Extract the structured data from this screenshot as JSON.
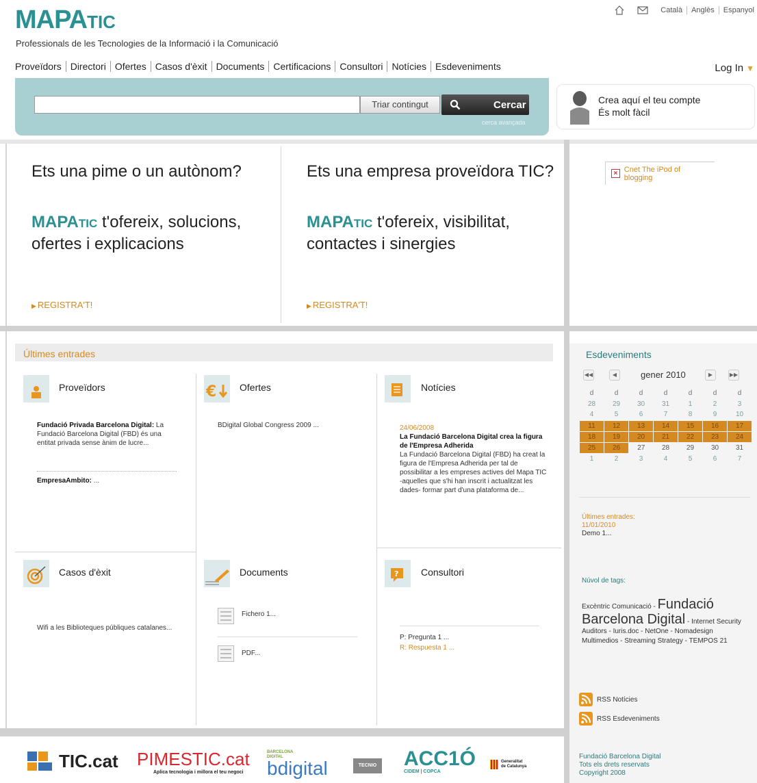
{
  "header": {
    "logo_big": "MAPA",
    "logo_small": "TIC",
    "tagline": "Professionals de les Tecnologies de la Informació i la Comunicació",
    "languages": [
      "Català",
      "Anglès",
      "Espanyol"
    ]
  },
  "nav": {
    "items": [
      "Proveïdors",
      "Directori",
      "Ofertes",
      "Casos d'èxit",
      "Documents",
      "Certificacions",
      "Consultori",
      "Notícies",
      "Esdeveniments"
    ],
    "login": "Log In"
  },
  "search": {
    "value": "",
    "content_select": "Triar contingut",
    "button": "Cercar",
    "advanced": "cerca avançada"
  },
  "account": {
    "line1": "Crea aquí el teu compte",
    "line2": "És molt fàcil"
  },
  "promo": [
    {
      "heading": "Ets una pime o un autònom?",
      "brand_big": "MAPA",
      "brand_small": "TIC",
      "body": " t'ofereix, solucions, ofertes i explicacions",
      "cta": "REGISTRA'T!"
    },
    {
      "heading": "Ets una empresa proveïdora TIC?",
      "brand_big": "MAPA",
      "brand_small": "TIC",
      "body": " t'ofereix, visibilitat, contactes i sinergies",
      "cta": "REGISTRA'T!"
    }
  ],
  "ad": {
    "text": "Cnet The iPod of blogging"
  },
  "ultimes": {
    "title": "Últimes entrades",
    "proveidors": {
      "title": "Proveïdors",
      "entry1_name": "Fundació Privada Barcelona Digital:",
      "entry1_text": " La Fundació Barcelona Digital (FBD) és una entitat privada sense ànim de lucre...",
      "entry2_name": "EmpresaAmbito:",
      "entry2_text": " ..."
    },
    "ofertes": {
      "title": "Ofertes",
      "entry": "BDigital Global Congress 2009 ..."
    },
    "noticies": {
      "title": "Notícies",
      "date": "24/06/2008",
      "headline": "La Fundació Barcelona Digital crea la figura de l'Empresa Adherida",
      "text": "La Fundació Barcelona Digital (FBD) ha creat la figura de l'Empresa Adherida per tal de possibilitar a les empreses actives del Mapa TIC -aquelles que s'hi han inscrit i actualitzat les dades- formar part d'una plataforma de..."
    },
    "casos": {
      "title": "Casos d'èxit",
      "entry": "Wifi a les Biblioteques públiques catalanes..."
    },
    "documents": {
      "title": "Documents",
      "file1": "Fichero 1...",
      "file2": "PDF..."
    },
    "consultori": {
      "title": "Consultori",
      "q": "P: Pregunta 1 ...",
      "r": "R: Respuesta 1 ..."
    }
  },
  "events": {
    "title": "Esdeveniments",
    "month": "gener 2010",
    "weekdays": [
      "d",
      "d",
      "d",
      "d",
      "d",
      "d",
      "d"
    ],
    "weeks": [
      [
        "28",
        "29",
        "30",
        "31",
        "1",
        "2",
        "3"
      ],
      [
        "4",
        "5",
        "6",
        "7",
        "8",
        "9",
        "10"
      ],
      [
        "11",
        "12",
        "13",
        "14",
        "15",
        "16",
        "17"
      ],
      [
        "18",
        "19",
        "20",
        "21",
        "22",
        "23",
        "24"
      ],
      [
        "25",
        "26",
        "27",
        "28",
        "29",
        "30",
        "31"
      ],
      [
        "1",
        "2",
        "3",
        "4",
        "5",
        "6",
        "7"
      ]
    ],
    "latest_label": "Últimes entrades:",
    "latest_date": "11/01/2010",
    "latest_item": "Demo 1..."
  },
  "tags": {
    "title": "Núvol de tags:",
    "t1": "Excèntric Comunicació",
    "t2": "Fundació Barcelona Digital",
    "t3": "Internet Security Auditors",
    "t4": "Iuris.doc",
    "t5": "NetOne",
    "t6": "Nomadesign Multimedios",
    "t7": "Streaming Strategy",
    "t8": "TEMPOS 21"
  },
  "rss": {
    "noticies": "RSS Notícies",
    "esdeveniments": "RSS Esdeveniments"
  },
  "footer": {
    "line1": "Fundació Barcelona Digital",
    "line2": "Tots els drets reservats",
    "line3": "Copyright 2008"
  },
  "sponsors": {
    "tic": "TIC.cat",
    "pimes": "PIMESTIC.cat",
    "pimes_sub": "Aplica tecnologia i millora el teu negoci",
    "bdigital": "bdigital",
    "bdigital_top": "BARCELONA DIGITAL",
    "tecnio": "TECNIO",
    "accio": "ACC1Ó",
    "accio_sub": "CIDEM | COPCA",
    "generalitat": "Generalitat de Catalunya"
  },
  "colors": {
    "teal": "#2a9092",
    "orange": "#d48a20",
    "searchband": "#a8d0d2"
  }
}
